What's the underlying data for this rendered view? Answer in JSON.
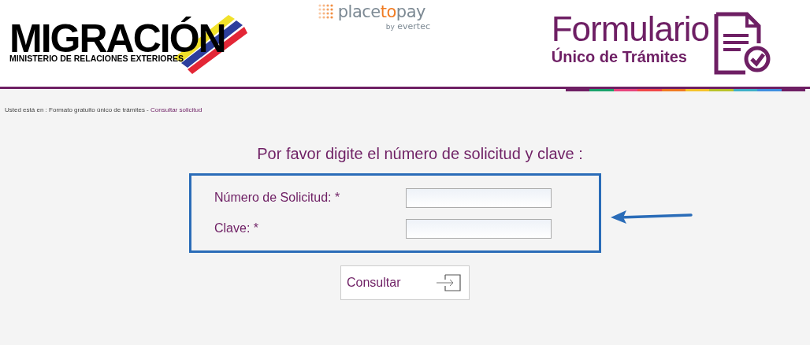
{
  "header": {
    "logo": {
      "title": "MIGRACIÓN",
      "subtitle": "MINISTERIO DE RELACIONES EXTERIORES"
    },
    "partner": {
      "parts": [
        "place",
        "to",
        "pay"
      ],
      "byline_prefix": "by",
      "byline": "evertec"
    },
    "form_brand": {
      "title": "Formulario",
      "subtitle": "Único de Trámites"
    }
  },
  "breadcrumb": {
    "prefix": "Usted está en :",
    "path": "Formato gratuito único de trámites -",
    "current": "Consultar solicitud"
  },
  "heading": "Por favor digite el número de solicitud y clave :",
  "fields": [
    {
      "label": "Número de Solicitud: *"
    },
    {
      "label": "Clave: *"
    }
  ],
  "submit": {
    "label": "Consultar"
  }
}
